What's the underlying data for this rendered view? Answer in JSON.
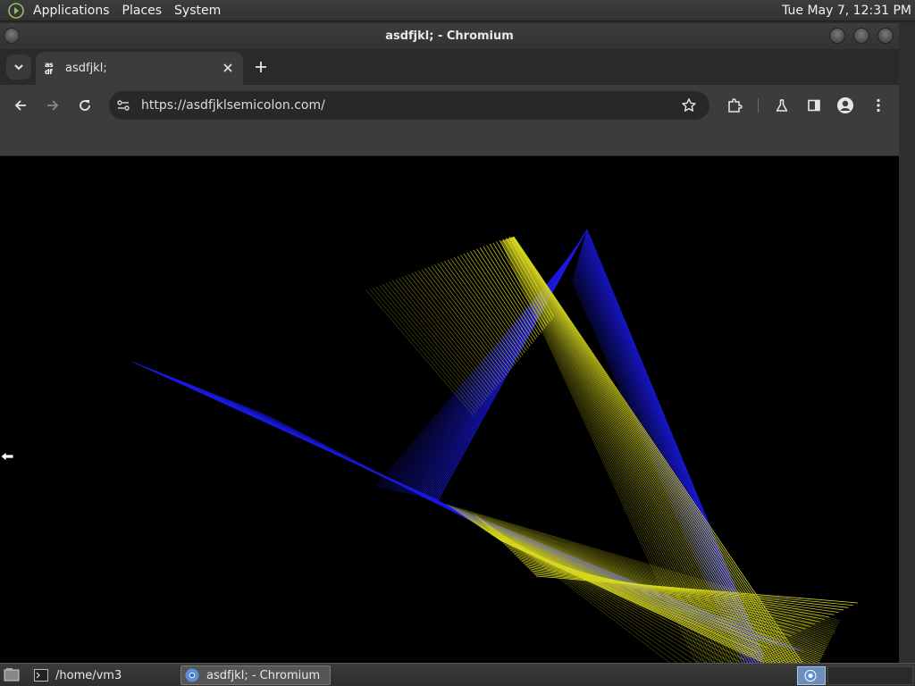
{
  "top_panel": {
    "menus": [
      "Applications",
      "Places",
      "System"
    ],
    "clock": "Tue May  7, 12:31 PM"
  },
  "window": {
    "title": "asdfjkl; - Chromium"
  },
  "tab": {
    "favicon_text": "as df",
    "title": "asdfjkl;"
  },
  "toolbar": {
    "url": "https://asdfjklsemicolon.com/"
  },
  "taskbar": {
    "items": [
      {
        "label": "/home/vm3",
        "icon": "terminal-icon"
      },
      {
        "label": "asdfjkl; - Chromium",
        "icon": "chromium-icon"
      }
    ]
  },
  "colors": {
    "blue_lines": "#1a1ae0",
    "yellow_lines": "#d8d820",
    "canvas_bg": "#000000"
  }
}
